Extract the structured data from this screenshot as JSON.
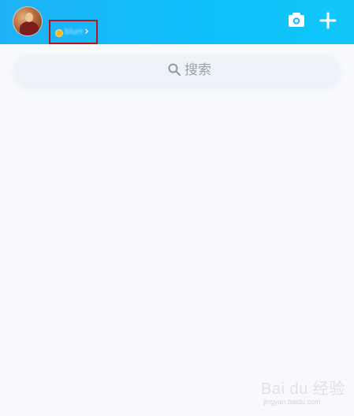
{
  "header": {
    "profile": {
      "status_text": "blurred"
    },
    "actions": {
      "camera_icon": "camera-icon",
      "add_icon": "plus-icon"
    }
  },
  "search": {
    "placeholder": "搜索",
    "icon": "search-icon"
  },
  "watermark": {
    "main": "Bai du 经验",
    "sub": "jingyan.baidu.com"
  },
  "colors": {
    "header_gradient_start": "#1fb1f6",
    "header_gradient_end": "#11c7fa",
    "highlight_box": "#b3161b",
    "search_bg": "#eef3f9",
    "placeholder_text": "#98a2ad",
    "page_bg": "#f7f9fc"
  }
}
